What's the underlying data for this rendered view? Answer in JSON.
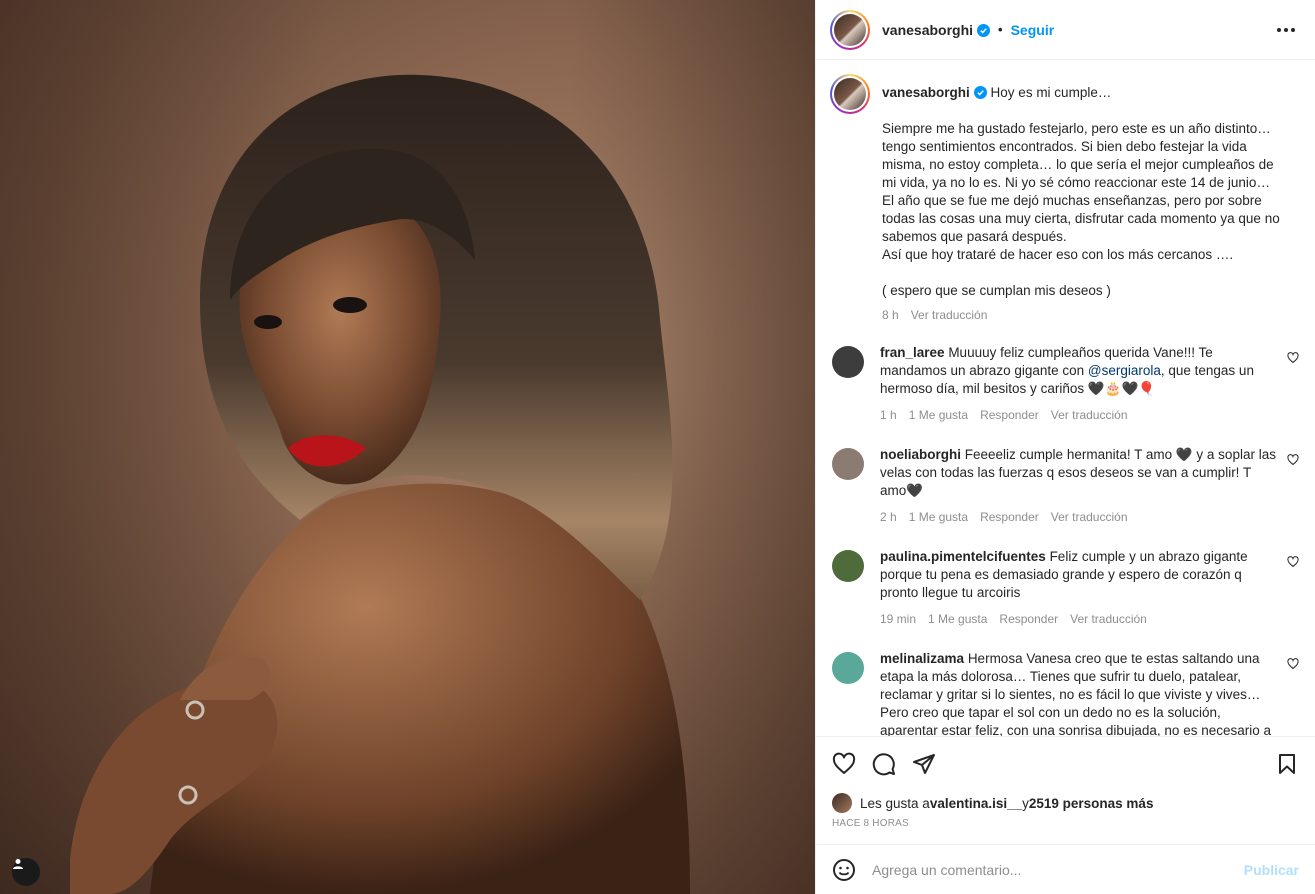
{
  "post": {
    "author": "vanesaborghi",
    "follow_label": "Seguir",
    "dot": "•"
  },
  "caption": {
    "user": "vanesaborghi",
    "first_line": "Hoy es mi cumple…",
    "text": "Siempre me ha gustado festejarlo, pero este es un año distinto… tengo sentimientos encontrados. Si bien debo festejar la vida misma, no estoy completa… lo que sería el mejor cumpleaños de mi vida, ya no lo es. Ni yo sé cómo reaccionar este 14 de junio… El año que se fue me dejó muchas enseñanzas, pero por sobre todas las cosas una muy cierta, disfrutar cada momento ya que no sabemos que pasará después.\nAsí que hoy trataré de hacer eso con los más cercanos ….\n\n( espero que se cumplan mis deseos )",
    "time": "8 h",
    "translate": "Ver traducción"
  },
  "comments": [
    {
      "user": "fran_laree",
      "text_before": "Muuuuy feliz cumpleaños querida Vane!!! Te mandamos un abrazo gigante con ",
      "mention": "@sergiarola",
      "text_after": ", que tengas un hermoso día, mil besitos y cariños 🖤🎂🖤🎈",
      "time": "1 h",
      "likes": "1 Me gusta",
      "reply": "Responder",
      "translate": "Ver traducción",
      "avatar_color": "#3d3d3d"
    },
    {
      "user": "noeliaborghi",
      "text_before": "Feeeeliz cumple hermanita! T amo 🖤 y a soplar las velas con todas las fuerzas q esos deseos se van a cumplir! T amo🖤",
      "mention": "",
      "text_after": "",
      "time": "2 h",
      "likes": "1 Me gusta",
      "reply": "Responder",
      "translate": "Ver traducción",
      "avatar_color": "#8c7b70"
    },
    {
      "user": "paulina.pimentelcifuentes",
      "text_before": "Feliz cumple y un abrazo gigante porque tu pena es demasiado grande y espero de corazón q pronto llegue tu arcoiris",
      "mention": "",
      "text_after": "",
      "time": "19 min",
      "likes": "1 Me gusta",
      "reply": "Responder",
      "translate": "Ver traducción",
      "avatar_color": "#4f6b3c"
    },
    {
      "user": "melinalizama",
      "text_before": "Hermosa Vanesa creo que te estas saltando una etapa la más dolorosa… Tienes que sufrir tu duelo, patalear, reclamar y gritar si lo sientes, no es fácil lo que viviste y vives… Pero creo que tapar el sol con un dedo no es la solución, aparentar estar feliz, con una sonrisa dibujada, no es necesario a",
      "mention": "",
      "text_after": "",
      "avatar_color": "#5aa89a"
    }
  ],
  "likes": {
    "prefix": "Les gusta a ",
    "user": "valentina.isi__",
    "middle": " y ",
    "count": "2519 personas más"
  },
  "timestamp": "HACE 8 HORAS",
  "add_comment": {
    "placeholder": "Agrega un comentario...",
    "post_label": "Publicar"
  },
  "colors": {
    "accent": "#0095f6",
    "muted": "#8e8e8e",
    "post_disabled": "#b2dffc"
  }
}
